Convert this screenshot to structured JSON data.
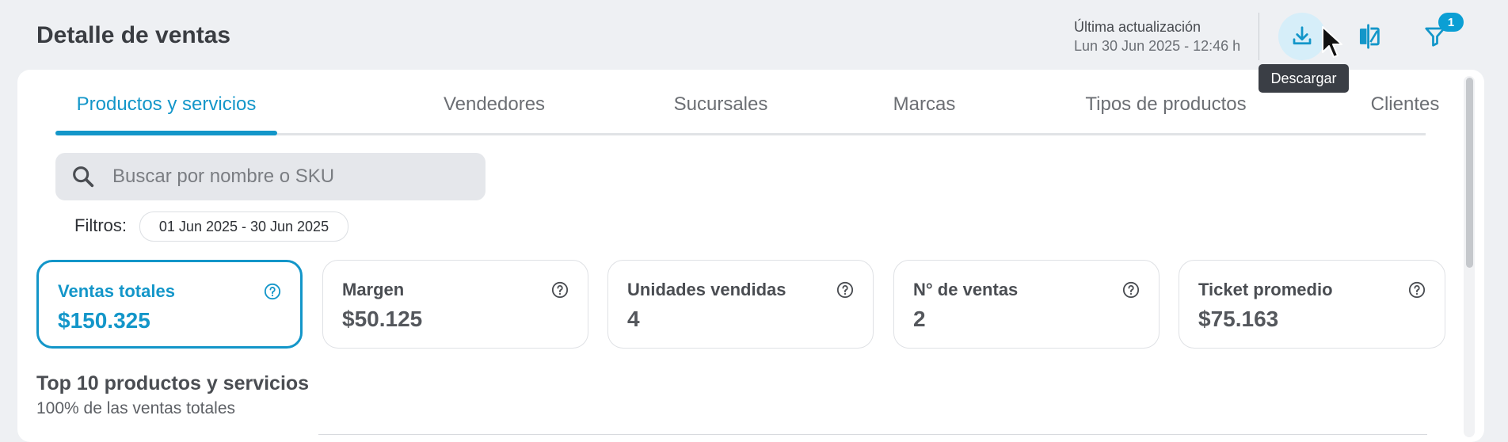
{
  "header": {
    "title": "Detalle de ventas",
    "last_update_label": "Última actualización",
    "last_update_value": "Lun 30 Jun 2025 - 12:46 h",
    "download_tooltip": "Descargar",
    "filter_badge": "1",
    "icons": [
      "download-icon",
      "compare-icon",
      "filter-icon"
    ]
  },
  "tabs": [
    {
      "label": "Productos y servicios",
      "active": true
    },
    {
      "label": "Vendedores"
    },
    {
      "label": "Sucursales"
    },
    {
      "label": "Marcas"
    },
    {
      "label": "Tipos de productos"
    },
    {
      "label": "Clientes"
    }
  ],
  "search": {
    "placeholder": "Buscar por nombre o SKU"
  },
  "filters": {
    "label": "Filtros:",
    "chip": "01 Jun 2025 - 30 Jun 2025"
  },
  "kpis": [
    {
      "label": "Ventas totales",
      "value": "$150.325",
      "active": true
    },
    {
      "label": "Margen",
      "value": "$50.125"
    },
    {
      "label": "Unidades vendidas",
      "value": "4"
    },
    {
      "label": "N° de ventas",
      "value": "2"
    },
    {
      "label": "Ticket promedio",
      "value": "$75.163"
    }
  ],
  "section": {
    "title": "Top 10 productos y servicios",
    "subtitle": "100% de las ventas totales"
  },
  "colors": {
    "accent": "#1396c9",
    "badge": "#0b9fd4",
    "tooltip_bg": "#3a3e45"
  }
}
